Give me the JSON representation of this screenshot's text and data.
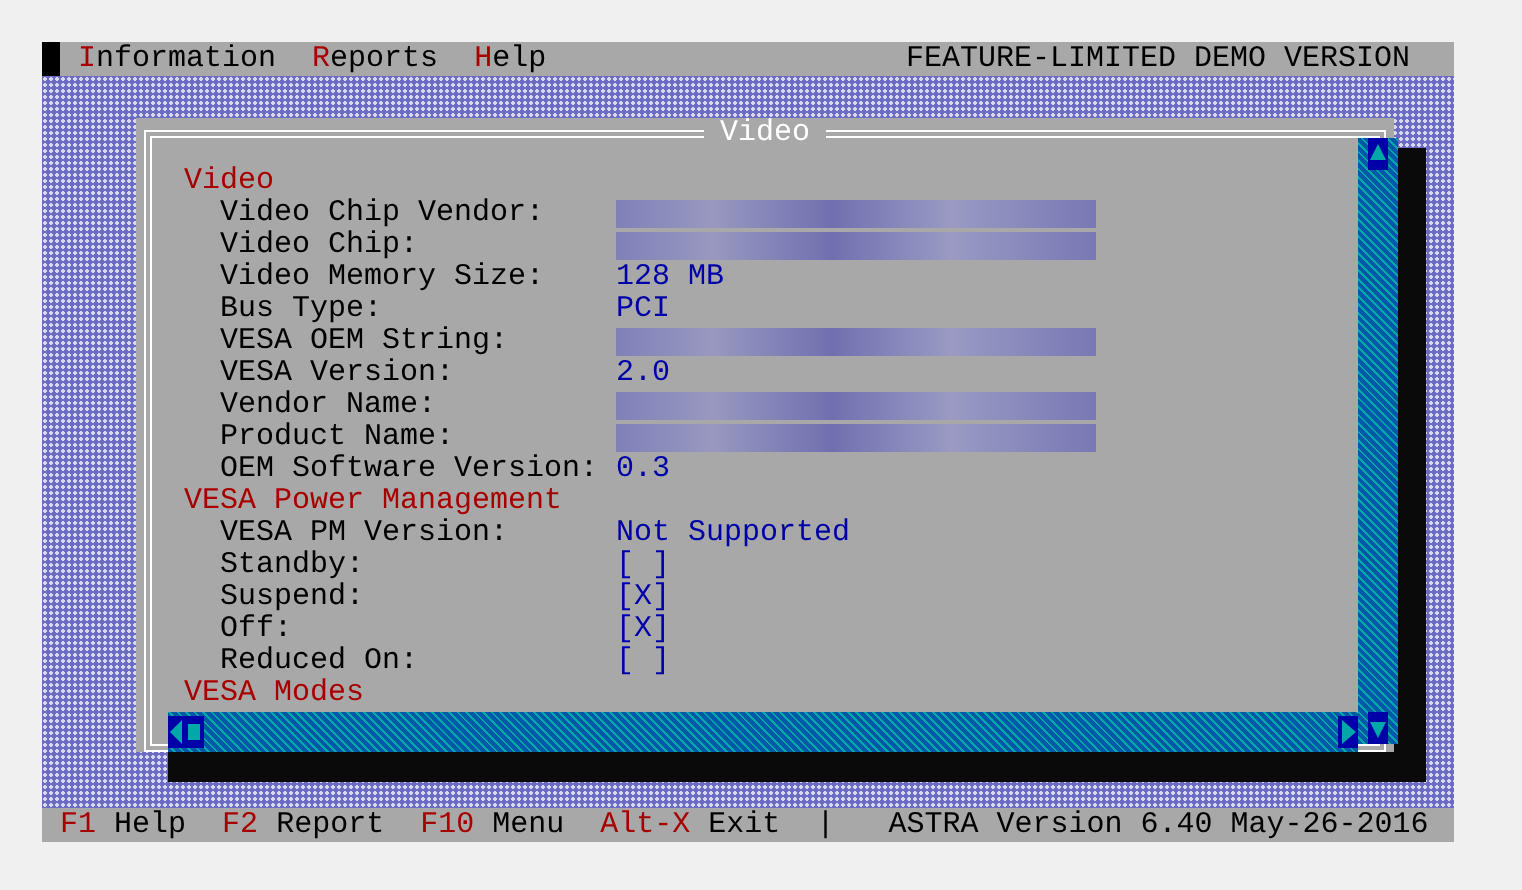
{
  "menu_bar": {
    "items": [
      {
        "hotkey": "I",
        "rest": "nformation"
      },
      {
        "hotkey": "R",
        "rest": "eports"
      },
      {
        "hotkey": "H",
        "rest": "elp"
      }
    ],
    "notice": "FEATURE-LIMITED DEMO VERSION"
  },
  "dialog": {
    "title": "Video",
    "sections": [
      {
        "heading": "Video",
        "rows": [
          {
            "label": "Video Chip Vendor:",
            "kind": "obscured"
          },
          {
            "label": "Video Chip:",
            "kind": "obscured"
          },
          {
            "label": "Video Memory Size:",
            "kind": "text",
            "value": "128 MB"
          },
          {
            "label": "Bus Type:",
            "kind": "text",
            "value": "PCI"
          },
          {
            "label": "VESA OEM String:",
            "kind": "obscured"
          },
          {
            "label": "VESA Version:",
            "kind": "text",
            "value": "2.0"
          },
          {
            "label": "Vendor Name:",
            "kind": "obscured"
          },
          {
            "label": "Product Name:",
            "kind": "obscured"
          },
          {
            "label": "OEM Software Version:",
            "kind": "text",
            "value": "0.3"
          }
        ]
      },
      {
        "heading": "VESA Power Management",
        "rows": [
          {
            "label": "VESA PM Version:",
            "kind": "text",
            "value": "Not Supported"
          },
          {
            "label": "Standby:",
            "kind": "text",
            "value": "[ ]"
          },
          {
            "label": "Suspend:",
            "kind": "text",
            "value": "[X]"
          },
          {
            "label": "Off:",
            "kind": "text",
            "value": "[X]"
          },
          {
            "label": "Reduced On:",
            "kind": "text",
            "value": "[ ]"
          }
        ]
      },
      {
        "heading": "VESA Modes"
      }
    ]
  },
  "status_bar": {
    "keys": [
      {
        "key": "F1",
        "label": "Help"
      },
      {
        "key": "F2",
        "label": "Report"
      },
      {
        "key": "F10",
        "label": "Menu"
      },
      {
        "key": "Alt-X",
        "label": "Exit"
      }
    ],
    "separator": "|",
    "version": "ASTRA Version 6.40",
    "date": "May-26-2016"
  }
}
